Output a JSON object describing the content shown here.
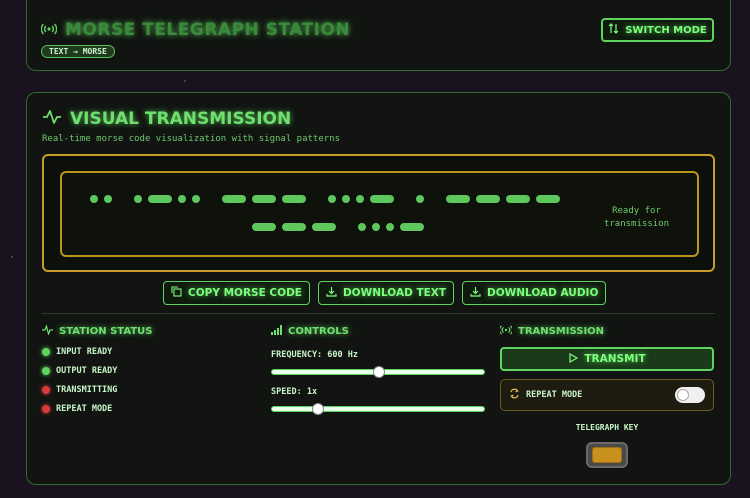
{
  "header": {
    "title": "MORSE TELEGRAPH STATION",
    "badge": "TEXT → MORSE",
    "switch_mode_label": "SWITCH MODE"
  },
  "visual": {
    "title": "VISUAL TRANSMISSION",
    "subtitle": "Real-time morse code visualization with signal patterns",
    "status_text_line1": "Ready for",
    "status_text_line2": "transmission",
    "morse_line1": [
      "..",
      ".-..",
      "---",
      "...-",
      ".",
      "----"
    ],
    "morse_line2": [
      "---",
      "...-"
    ]
  },
  "actions": {
    "copy_label": "COPY MORSE CODE",
    "download_text_label": "DOWNLOAD TEXT",
    "download_audio_label": "DOWNLOAD AUDIO"
  },
  "station_status": {
    "title": "STATION STATUS",
    "items": [
      {
        "label": "INPUT READY",
        "color": "#5fd35f"
      },
      {
        "label": "OUTPUT READY",
        "color": "#5fd35f"
      },
      {
        "label": "TRANSMITTING",
        "color": "#d63a3a"
      },
      {
        "label": "REPEAT MODE",
        "color": "#d63a3a"
      }
    ]
  },
  "controls": {
    "title": "CONTROLS",
    "frequency_label": "FREQUENCY: 600 Hz",
    "frequency_fraction": 0.5,
    "speed_label": "SPEED: 1x",
    "speed_fraction": 0.2
  },
  "transmission": {
    "title": "TRANSMISSION",
    "transmit_label": "TRANSMIT",
    "repeat_label": "REPEAT MODE",
    "repeat_on": false,
    "key_label": "TELEGRAPH KEY"
  },
  "colors": {
    "accent": "#5fd35f",
    "gold": "#c89b2a",
    "alert": "#d63a3a"
  }
}
